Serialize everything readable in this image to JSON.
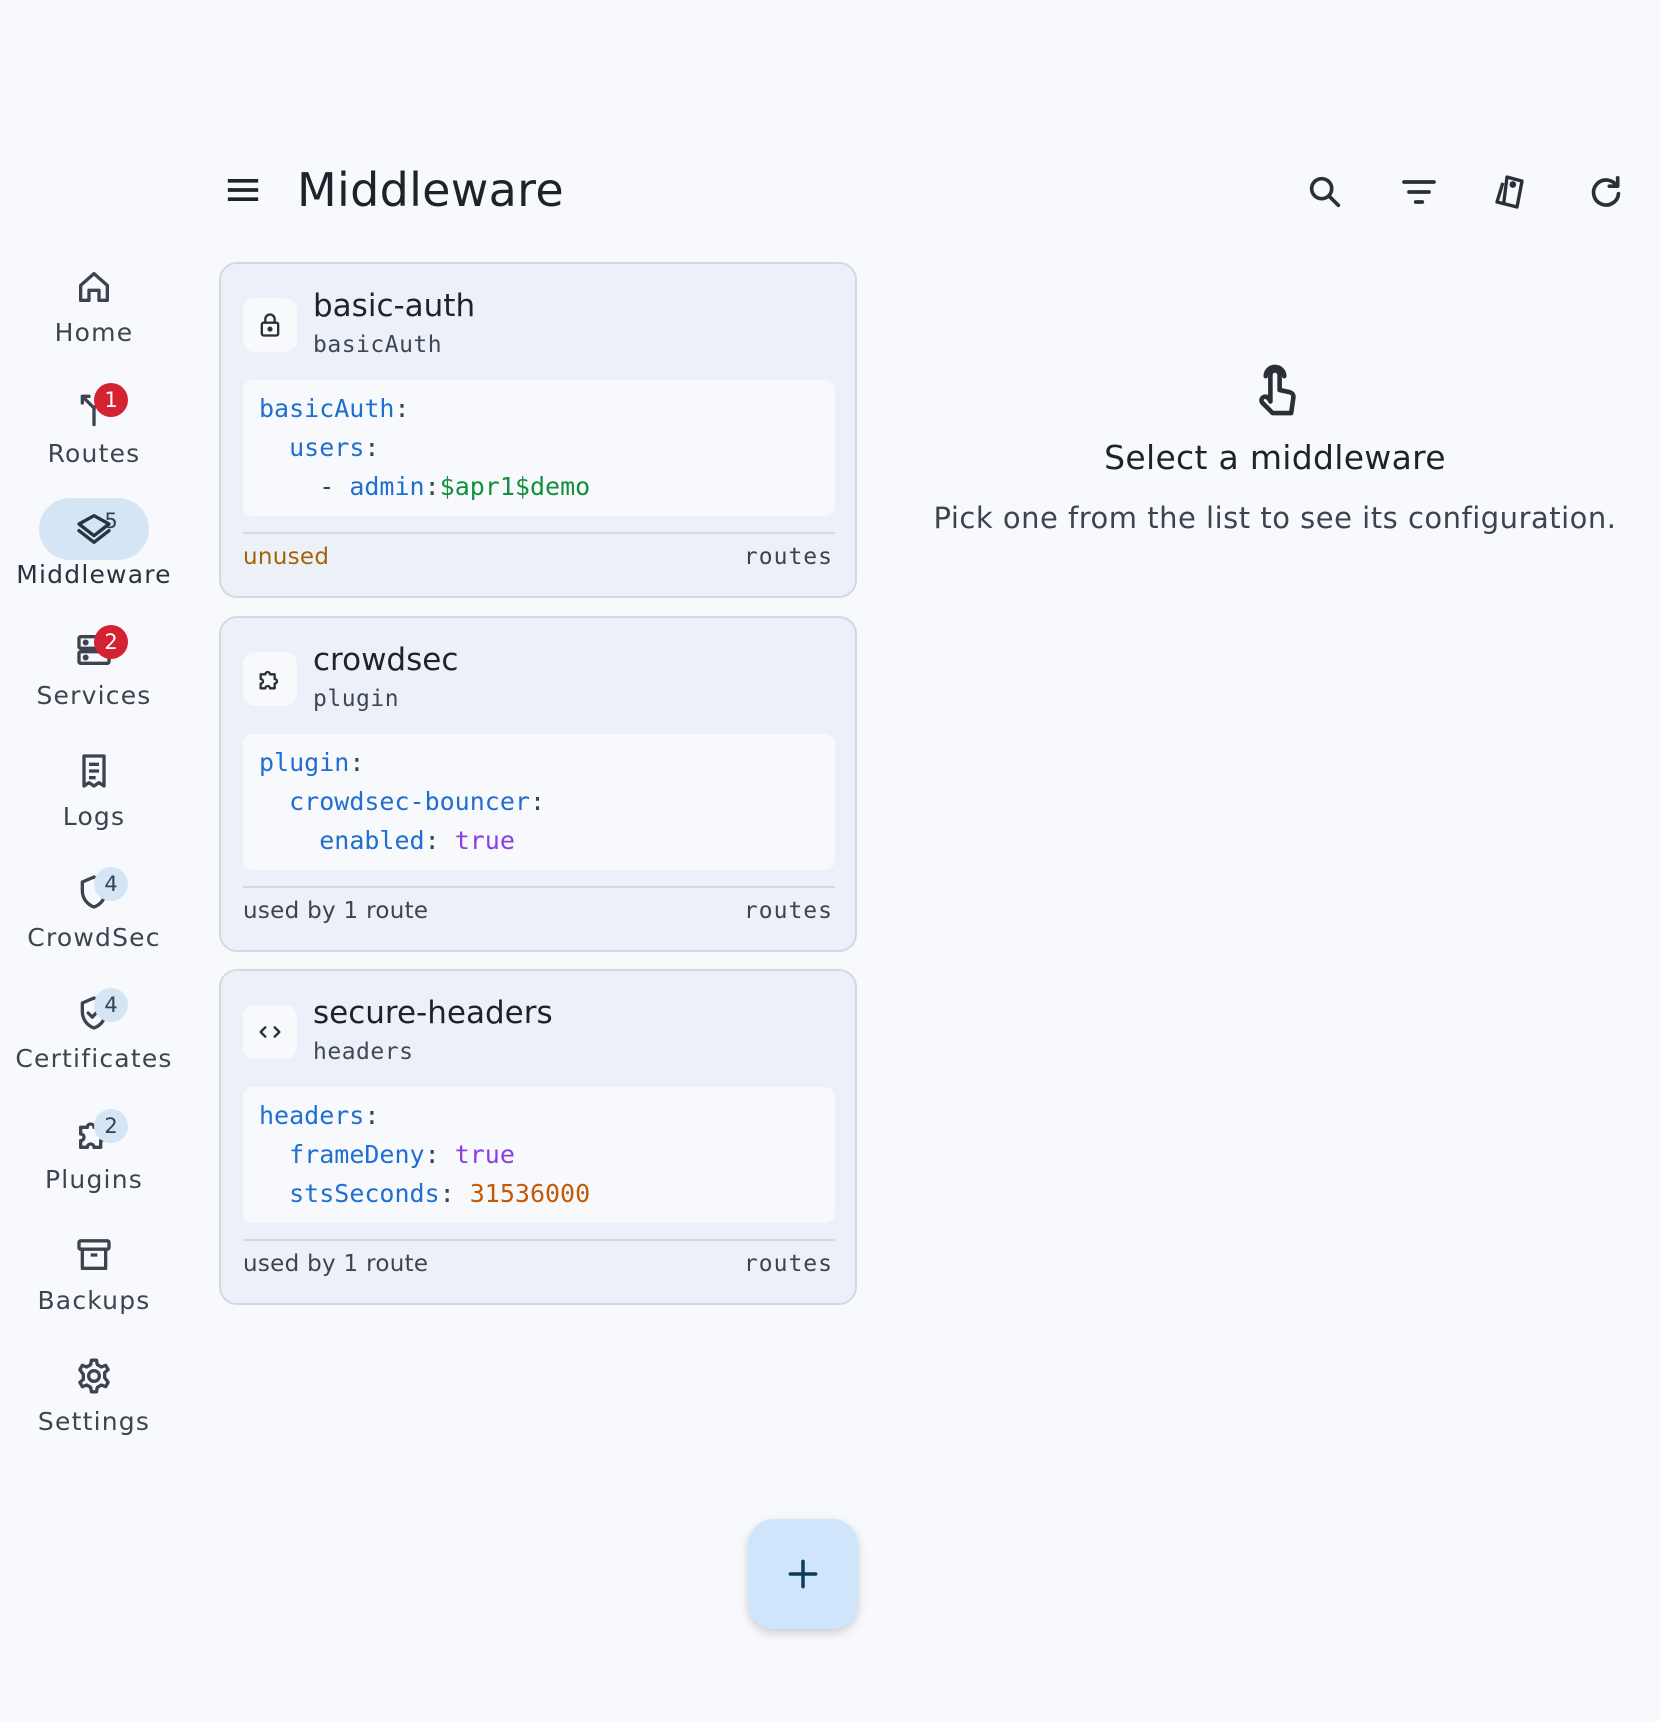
{
  "header": {
    "title": "Middleware"
  },
  "nav": {
    "items": [
      {
        "label": "Home",
        "icon": "home-icon",
        "badge": ""
      },
      {
        "label": "Routes",
        "icon": "routes-icon",
        "badge": "1",
        "badge_style": "error"
      },
      {
        "label": "Middleware",
        "icon": "layers-icon",
        "badge": "5",
        "badge_style": "soft",
        "active": true
      },
      {
        "label": "Services",
        "icon": "services-icon",
        "badge": "2",
        "badge_style": "error"
      },
      {
        "label": "Logs",
        "icon": "logs-icon",
        "badge": ""
      },
      {
        "label": "CrowdSec",
        "icon": "shield-icon",
        "badge": "4",
        "badge_style": "soft"
      },
      {
        "label": "Certificates",
        "icon": "verified-shield-icon",
        "badge": "4",
        "badge_style": "soft"
      },
      {
        "label": "Plugins",
        "icon": "puzzle-icon",
        "badge": "2",
        "badge_style": "soft"
      },
      {
        "label": "Backups",
        "icon": "archive-icon",
        "badge": ""
      },
      {
        "label": "Settings",
        "icon": "gear-icon",
        "badge": ""
      }
    ]
  },
  "actions": [
    "search-icon",
    "filter-icon",
    "tags-icon",
    "refresh-icon"
  ],
  "cards": [
    {
      "name": "basic-auth",
      "type": "basicAuth",
      "icon": "lock-icon",
      "code": {
        "l1_key": "basicAuth",
        "l1_punct": ":",
        "l2_key": "users",
        "l2_punct": ":",
        "l3_dash": "- ",
        "l3_key": "admin",
        "l3_punct": ":",
        "l3_value": "$apr1$demo"
      },
      "usage": "unused",
      "link": "routes"
    },
    {
      "name": "crowdsec",
      "type": "plugin",
      "icon": "puzzle-icon",
      "code": {
        "l1_key": "plugin",
        "l1_punct": ":",
        "l2_key": "crowdsec-bouncer",
        "l2_punct": ":",
        "l3_key": "enabled",
        "l3_punct": ": ",
        "l3_value": "true"
      },
      "usage": "used by 1 route",
      "link": "routes"
    },
    {
      "name": "secure-headers",
      "type": "headers",
      "icon": "code-icon",
      "code": {
        "l1_key": "headers",
        "l1_punct": ":",
        "l2_key": "frameDeny",
        "l2_punct": ": ",
        "l2_value": "true",
        "l3_key": "stsSeconds",
        "l3_punct": ": ",
        "l3_value": "31536000"
      },
      "usage": "used by 1 route",
      "link": "routes"
    }
  ],
  "empty_state": {
    "icon": "touch-icon",
    "title": "Select a middleware",
    "subtitle": "Pick one from the list to see its configuration."
  },
  "fab": {
    "icon": "plus-icon"
  },
  "colors": {
    "accent": "#d4e5f6",
    "error_badge": "#d32232",
    "yaml_key": "#1f6fd0",
    "yaml_string": "#12903c",
    "yaml_bool": "#8a3fe2",
    "yaml_number": "#c45a06",
    "unused": "#a26404"
  }
}
